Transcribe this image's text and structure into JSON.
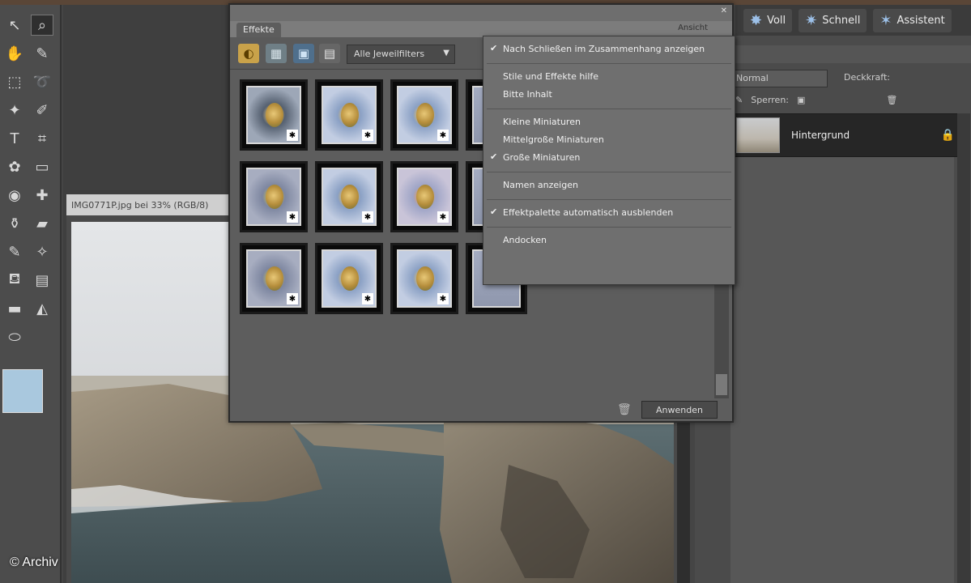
{
  "colors": {
    "toolbox_bg": "#4c4c4c",
    "panel_bg": "#5d5d5d",
    "menu_bg": "#6f6f6f",
    "layer_row_bg": "#262626",
    "foreground_color": "#a9c8de",
    "background_color": "#f5f5f5"
  },
  "toolbox": {
    "tools": [
      {
        "icon": "move-icon",
        "glyph": "↖"
      },
      {
        "icon": "zoom-icon",
        "glyph": "⌕"
      },
      {
        "icon": "hand-icon",
        "glyph": "✋"
      },
      {
        "icon": "eyedropper-icon",
        "glyph": "✎"
      },
      {
        "icon": "marquee-icon",
        "glyph": "⬚"
      },
      {
        "icon": "lasso-icon",
        "glyph": "➰"
      },
      {
        "icon": "magic-wand-icon",
        "glyph": "✦"
      },
      {
        "icon": "selection-brush-icon",
        "glyph": "✐"
      },
      {
        "icon": "type-icon",
        "glyph": "T"
      },
      {
        "icon": "crop-icon",
        "glyph": "⌗"
      },
      {
        "icon": "cookie-cutter-icon",
        "glyph": "✿"
      },
      {
        "icon": "straighten-icon",
        "glyph": "▭"
      },
      {
        "icon": "red-eye-icon",
        "glyph": "◉"
      },
      {
        "icon": "healing-brush-icon",
        "glyph": "✚"
      },
      {
        "icon": "clone-stamp-icon",
        "glyph": "⚱"
      },
      {
        "icon": "eraser-icon",
        "glyph": "▰"
      },
      {
        "icon": "brush-icon",
        "glyph": "✎"
      },
      {
        "icon": "smart-brush-icon",
        "glyph": "✧"
      },
      {
        "icon": "paint-bucket-icon",
        "glyph": "⛾"
      },
      {
        "icon": "gradient-icon",
        "glyph": "▤"
      },
      {
        "icon": "shape-icon",
        "glyph": "▬"
      },
      {
        "icon": "blur-icon",
        "glyph": "◭"
      },
      {
        "icon": "sponge-icon",
        "glyph": "⬭"
      }
    ]
  },
  "photo_window": {
    "title": "IMG0771P.jpg bei 33% (RGB/8)"
  },
  "right_panel": {
    "buttons": [
      {
        "label": "Voll",
        "icon": "full-edit-icon"
      },
      {
        "label": "Schnell",
        "icon": "quick-fix-icon"
      },
      {
        "label": "Assistent",
        "icon": "guided-icon"
      }
    ],
    "blend_mode": "Normal",
    "opacity_label": "Deckkraft:",
    "lock_label": "Sperren:",
    "layer_name": "Hintergrund"
  },
  "effects_panel": {
    "tab_label": "Effekte",
    "menu_button_label": "Ansicht",
    "filter_dropdown": "Alle Jeweilfilters",
    "apply_label": "Anwenden",
    "thumbnails": [
      {
        "badge": "✱",
        "variant": "cut-paste"
      },
      {
        "badge": "✱",
        "variant": "blue"
      },
      {
        "badge": "✱",
        "variant": "blue"
      },
      {
        "badge": "✱",
        "variant": "partial"
      },
      {
        "badge": "✱",
        "variant": "muted"
      },
      {
        "badge": "✱",
        "variant": "blue"
      },
      {
        "badge": "✱",
        "variant": "pink"
      },
      {
        "badge": "✱",
        "variant": "partial"
      },
      {
        "badge": "✱",
        "variant": "muted"
      },
      {
        "badge": "✱",
        "variant": "blue"
      },
      {
        "badge": "✱",
        "variant": "blue"
      },
      {
        "badge": "✱",
        "variant": "partial"
      }
    ]
  },
  "context_menu": {
    "items": [
      {
        "label": "Nach Schließen im Zusammenhang anzeigen",
        "checked": true,
        "group": 0
      },
      {
        "label": "Stile und Effekte hilfe",
        "checked": false,
        "group": 1
      },
      {
        "label": "Bitte Inhalt",
        "checked": false,
        "group": 1
      },
      {
        "label": "Kleine Miniaturen",
        "checked": false,
        "group": 2
      },
      {
        "label": "Mittelgroße Miniaturen",
        "checked": false,
        "group": 2
      },
      {
        "label": "Große Miniaturen",
        "checked": true,
        "group": 2
      },
      {
        "label": "Namen anzeigen",
        "checked": false,
        "group": 3
      },
      {
        "label": "Effektpalette automatisch ausblenden",
        "checked": true,
        "group": 4
      },
      {
        "label": "Andocken",
        "checked": false,
        "group": 5
      }
    ]
  },
  "copyright": "© Archiv"
}
